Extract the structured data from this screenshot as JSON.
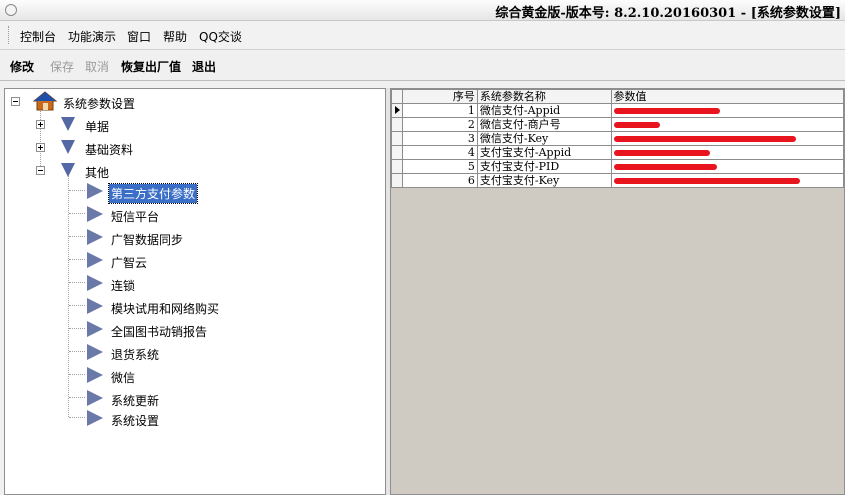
{
  "window": {
    "title": "综合黄金版-版本号: 8.2.10.20160301 - [系统参数设置]"
  },
  "menu": {
    "items": [
      "控制台",
      "功能演示",
      "窗口",
      "帮助",
      "QQ交谈"
    ]
  },
  "toolbar": {
    "modify": "修改",
    "save": "保存",
    "cancel": "取消",
    "restore": "恢复出厂值",
    "exit": "退出"
  },
  "tree": {
    "root": "系统参数设置",
    "nodes": [
      "单据",
      "基础资料",
      "其他"
    ],
    "children": [
      "第三方支付参数",
      "短信平台",
      "广智数据同步",
      "广智云",
      "连锁",
      "模块试用和网络购买",
      "全国图书动销报告",
      "退货系统",
      "微信",
      "系统更新",
      "系统设置"
    ],
    "selected_child": "第三方支付参数"
  },
  "grid": {
    "columns": [
      "序号",
      "系统参数名称",
      "参数值"
    ],
    "rows": [
      {
        "no": "1",
        "name": "微信支付-Appid"
      },
      {
        "no": "2",
        "name": "微信支付-商户号"
      },
      {
        "no": "3",
        "name": "微信支付-Key"
      },
      {
        "no": "4",
        "name": "支付宝支付-Appid"
      },
      {
        "no": "5",
        "name": "支付宝支付-PID"
      },
      {
        "no": "6",
        "name": "支付宝支付-Key"
      }
    ]
  },
  "icons": {
    "title": "window-circle-icon",
    "root": "home-icon",
    "nodes": "triangle-down-icon",
    "children": "triangle-right-icon"
  },
  "colors": {
    "selection": "#3a6ec7",
    "redaction": "#e8141e",
    "tree_icon": "#5468a6",
    "grid_background": "#cfcbc3"
  }
}
